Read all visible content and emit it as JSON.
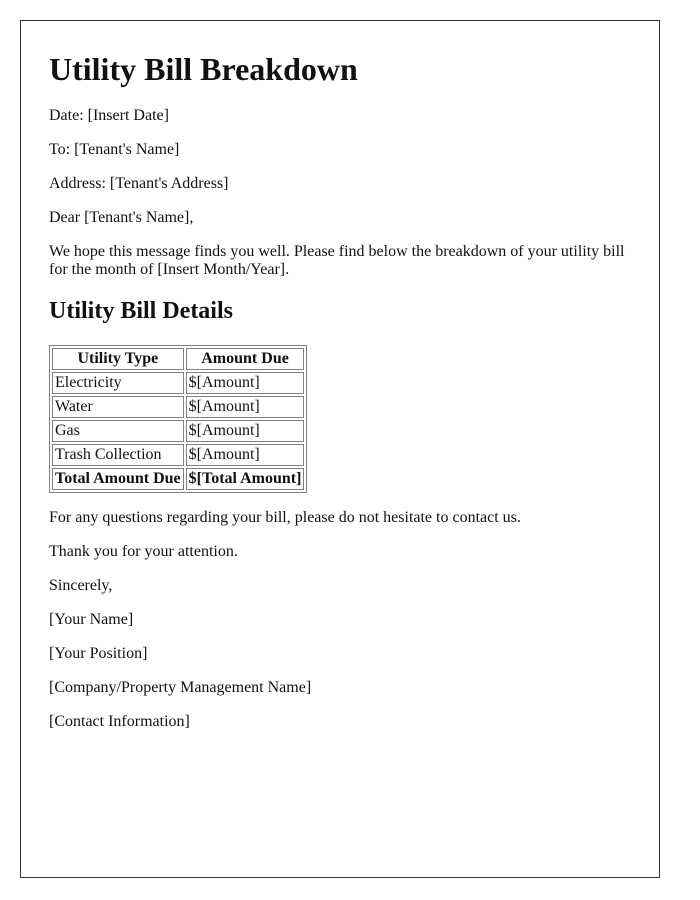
{
  "document": {
    "title": "Utility Bill Breakdown",
    "date_line": "Date: [Insert Date]",
    "to_line": "To: [Tenant's Name]",
    "address_line": "Address: [Tenant's Address]",
    "salutation": "Dear [Tenant's Name],",
    "intro": "We hope this message finds you well. Please find below the breakdown of your utility bill for the month of [Insert Month/Year].",
    "details_heading": "Utility Bill Details",
    "table": {
      "headers": [
        "Utility Type",
        "Amount Due"
      ],
      "rows": [
        [
          "Electricity",
          "$[Amount]"
        ],
        [
          "Water",
          "$[Amount]"
        ],
        [
          "Gas",
          "$[Amount]"
        ],
        [
          "Trash Collection",
          "$[Amount]"
        ]
      ],
      "total": [
        "Total Amount Due",
        "$[Total Amount]"
      ]
    },
    "questions": "For any questions regarding your bill, please do not hesitate to contact us.",
    "thanks": "Thank you for your attention.",
    "closing": "Sincerely,",
    "signature": {
      "name": "[Your Name]",
      "position": "[Your Position]",
      "company": "[Company/Property Management Name]",
      "contact": "[Contact Information]"
    }
  }
}
